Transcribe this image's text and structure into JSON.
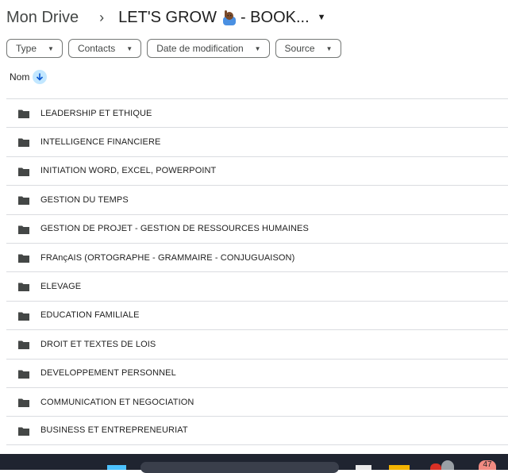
{
  "breadcrumb": {
    "root": "Mon Drive",
    "separator": "›",
    "current": "LET'S GROW",
    "current_suffix": "- BOOK...",
    "emoji_icon": "person-raising-hand-icon"
  },
  "filters": [
    {
      "label": "Type"
    },
    {
      "label": "Contacts"
    },
    {
      "label": "Date de modification"
    },
    {
      "label": "Source"
    }
  ],
  "column": {
    "name": "Nom",
    "sort_icon": "arrow-down-icon"
  },
  "folders": [
    "LEADERSHIP ET ETHIQUE",
    "INTELLIGENCE FINANCIERE",
    "INITIATION WORD, EXCEL, POWERPOINT",
    "GESTION DU TEMPS",
    "GESTION DE PROJET - GESTION DE RESSOURCES HUMAINES",
    "FRAnçAIS (ORTOGRAPHE - GRAMMAIRE - CONJUGUAISON)",
    "ELEVAGE",
    "EDUCATION FAMILIALE",
    "DROIT ET TEXTES DE LOIS",
    "DEVELOPPEMENT PERSONNEL",
    "COMMUNICATION ET NEGOCIATION",
    "BUSINESS ET ENTREPRENEURIAT"
  ],
  "taskbar": {
    "badge": "47"
  },
  "colors": {
    "accent": "#c2e7ff",
    "arrow": "#0b57d0",
    "folder": "#444746"
  }
}
